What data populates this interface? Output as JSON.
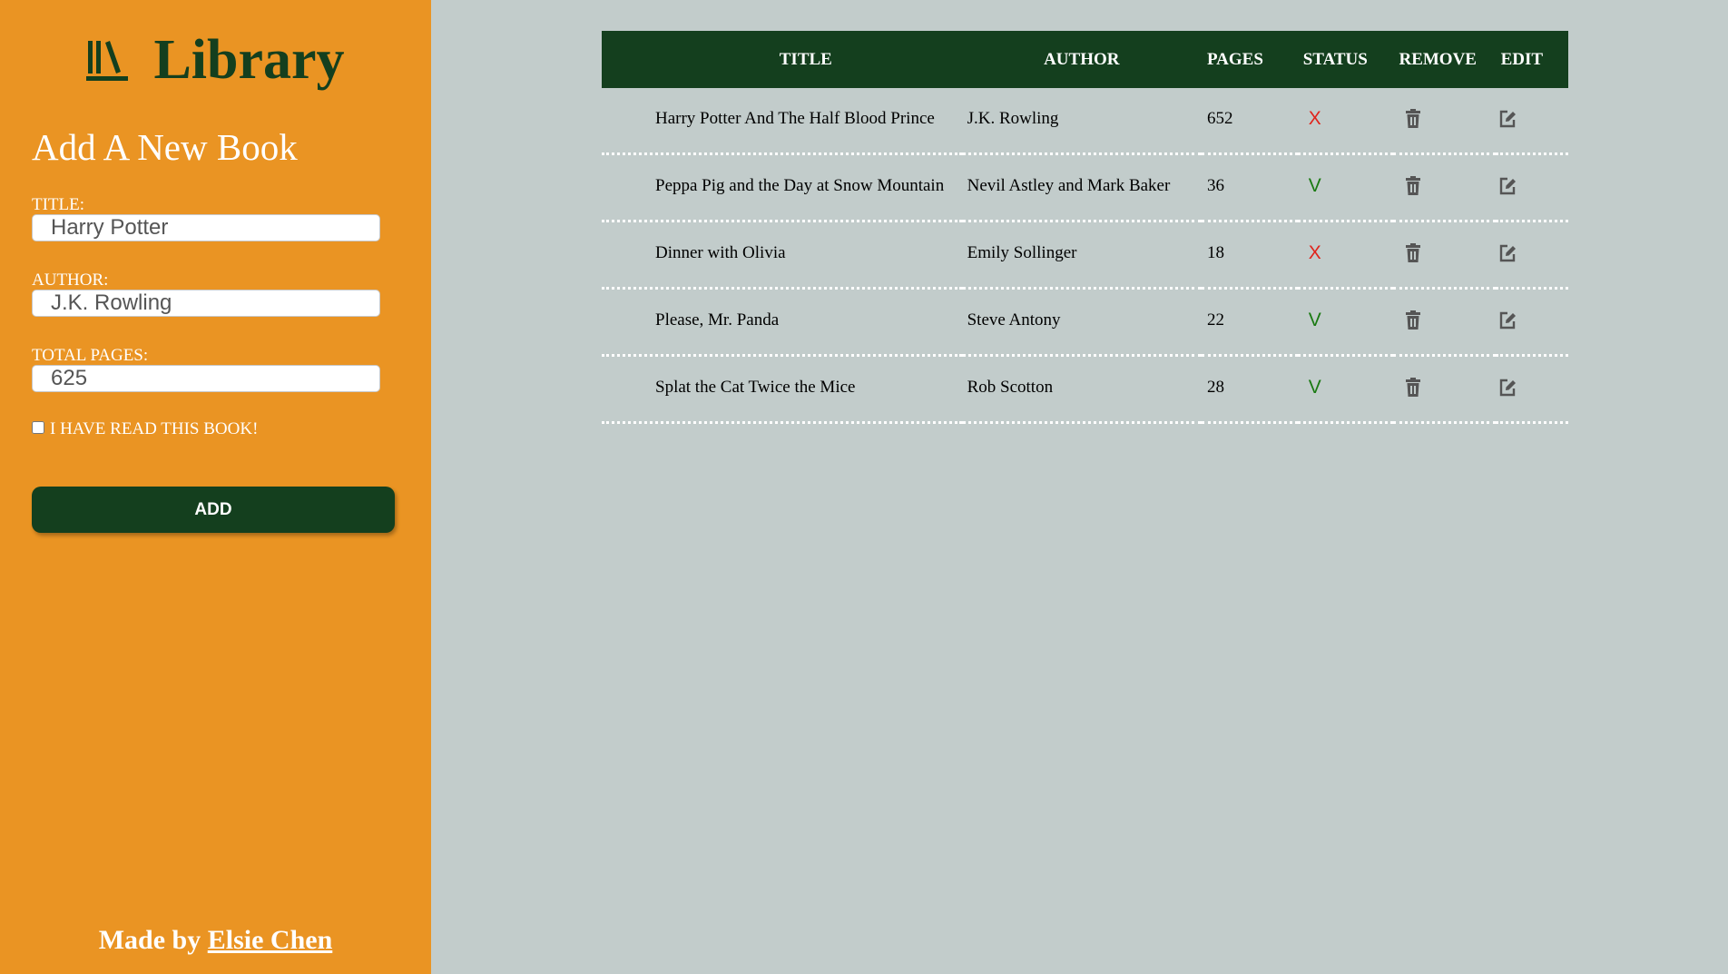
{
  "colors": {
    "sidebar_bg": "#ea9423",
    "main_bg": "#c2cccb",
    "accent_dark_green": "#143f1e",
    "status_unread": "#e0241c",
    "status_read": "#1a7a12"
  },
  "sidebar": {
    "logo_icon": "books-icon",
    "title": "Library",
    "form": {
      "heading": "Add A New Book",
      "title_label": "TITLE:",
      "title_value": "Harry Potter",
      "author_label": "AUTHOR:",
      "author_value": "J.K. Rowling",
      "pages_label": "TOTAL PAGES:",
      "pages_value": "625",
      "read_label": "I HAVE READ THIS BOOK!",
      "read_checked": false,
      "add_label": "ADD"
    },
    "footer": {
      "prefix": "Made by",
      "author_link": "Elsie Chen"
    }
  },
  "table": {
    "headers": {
      "title": "TITLE",
      "author": "AUTHOR",
      "pages": "PAGES",
      "status": "STATUS",
      "remove": "REMOVE",
      "edit": "EDIT"
    },
    "remove_icon": "trash-icon",
    "edit_icon": "edit-icon",
    "rows": [
      {
        "title": "Harry Potter And The Half Blood Prince",
        "author": "J.K. Rowling",
        "pages": "652",
        "status": "X",
        "read": false
      },
      {
        "title": "Peppa Pig and the Day at Snow Mountain",
        "author": "Nevil Astley and Mark Baker",
        "pages": "36",
        "status": "V",
        "read": true
      },
      {
        "title": "Dinner with Olivia",
        "author": "Emily Sollinger",
        "pages": "18",
        "status": "X",
        "read": false
      },
      {
        "title": "Please, Mr. Panda",
        "author": "Steve Antony",
        "pages": "22",
        "status": "V",
        "read": true
      },
      {
        "title": "Splat the Cat Twice the Mice",
        "author": "Rob Scotton",
        "pages": "28",
        "status": "V",
        "read": true
      }
    ]
  }
}
